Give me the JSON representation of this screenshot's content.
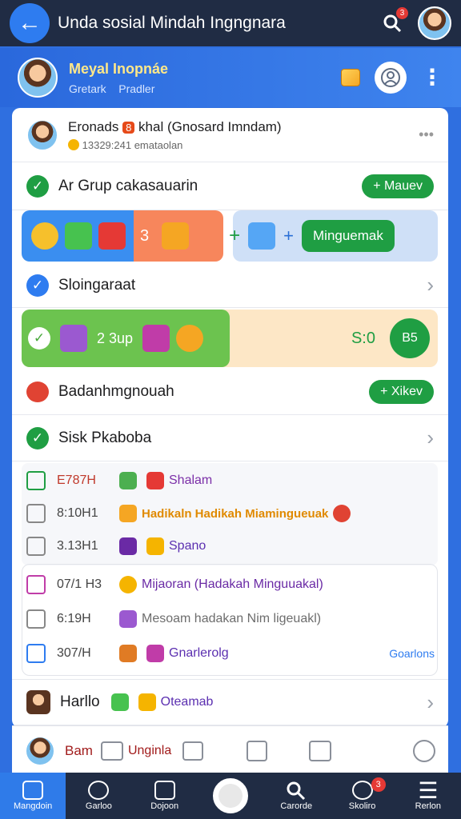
{
  "topbar": {
    "title": "Unda sosial Mindah Ingngnara",
    "search_badge": "3"
  },
  "profile": {
    "name": "Meyal Inopnáe",
    "tabs": [
      "Gretark",
      "Pradler"
    ]
  },
  "post": {
    "title": "Eronads",
    "title_badge": "8",
    "title_rest": "khal (Gnosard Imndam)",
    "meta": "13329:241 emataolan",
    "more": "•••"
  },
  "sections": {
    "group": {
      "label": "Ar Grup cakasauarin",
      "button": "+ Mauev"
    },
    "strip1": {
      "num": "3",
      "plus": "+",
      "plus2": "+",
      "button": "Minguemak"
    },
    "sloing": {
      "label": "Sloingaraat"
    },
    "strip2": {
      "text": "2 3up",
      "score": "S:0",
      "circle": "B5"
    },
    "badan": {
      "label": "Badanhmgnouah",
      "button": "+ Xikev"
    },
    "sisk": {
      "label": "Sisk Pkaboba"
    }
  },
  "list_a": [
    {
      "time": "E787H",
      "text": "Shalam",
      "color": "#7b2fa8"
    },
    {
      "time": "8:10H1",
      "text": "Hadikaln Hadikah Miamingueuak",
      "color": "#e08a00"
    },
    {
      "time": "3.13H1",
      "text": "Spano",
      "color": "#5b2fb0"
    }
  ],
  "list_b": [
    {
      "time": "07/1 H3",
      "text": "Mijaoran (Hadakah Minguuakal)",
      "color": "#6a2aa5"
    },
    {
      "time": "6:19H",
      "text": "Mesoam hadakan Nim ligeuakl)",
      "color": "#6d6d6d"
    },
    {
      "time": "307/H",
      "text": "Gnarlerolg",
      "color": "#5b2fb0"
    }
  ],
  "list_b_link": "Goarlons",
  "hario": {
    "label": "Harllo",
    "text": "Oteamab"
  },
  "bottom": {
    "name": "Bam",
    "text": "Unginla"
  },
  "nav": [
    "Mangdoin",
    "Garloo",
    "Dojoon",
    "",
    "Carorde",
    "Skoliro",
    "Rerlon"
  ],
  "nav_badge": "3"
}
